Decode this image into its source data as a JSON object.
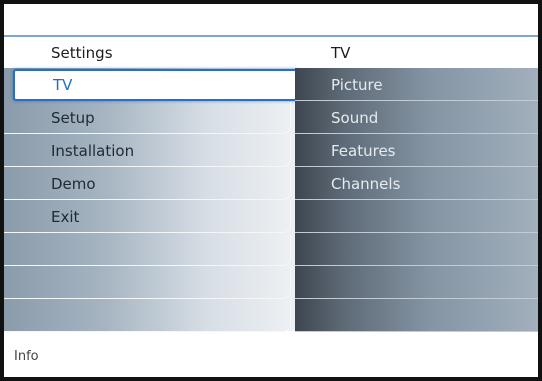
{
  "header": {
    "left_title": "Settings",
    "right_title": "TV"
  },
  "menu": {
    "items": [
      {
        "label": "TV",
        "selected": true
      },
      {
        "label": "Setup"
      },
      {
        "label": "Installation"
      },
      {
        "label": "Demo"
      },
      {
        "label": "Exit"
      },
      {
        "label": ""
      },
      {
        "label": ""
      },
      {
        "label": ""
      }
    ]
  },
  "submenu": {
    "items": [
      {
        "label": "Picture"
      },
      {
        "label": "Sound"
      },
      {
        "label": "Features"
      },
      {
        "label": "Channels"
      },
      {
        "label": ""
      },
      {
        "label": ""
      },
      {
        "label": ""
      },
      {
        "label": ""
      }
    ]
  },
  "footer": {
    "info_label": "Info"
  },
  "colors": {
    "selection_border": "#2a6fc3",
    "selected_text": "#1f6fc0",
    "header_rule": "#7ea6cf"
  }
}
